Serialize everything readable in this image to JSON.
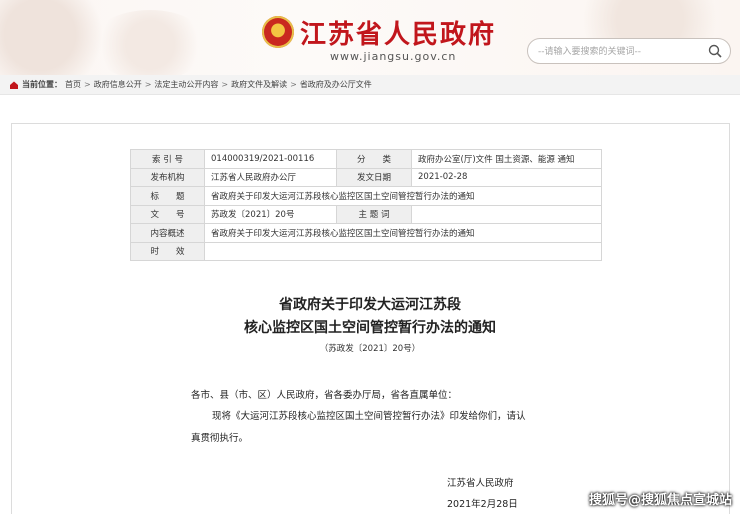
{
  "header": {
    "site_title": "江苏省人民政府",
    "site_url": "www.jiangsu.gov.cn",
    "search_placeholder": "--请输入要搜索的关键词--"
  },
  "breadcrumb": {
    "label": "当前位置：",
    "items": [
      "首页",
      "政府信息公开",
      "法定主动公开内容",
      "政府文件及解读",
      "省政府及办公厅文件"
    ]
  },
  "meta": {
    "rows": [
      {
        "k1": "索 引 号",
        "v1": "014000319/2021-00116",
        "k2": "分　　类",
        "v2": "政府办公室(厅)文件 国土资源、能源 通知"
      },
      {
        "k1": "发布机构",
        "v1": "江苏省人民政府办公厅",
        "k2": "发文日期",
        "v2": "2021-02-28"
      },
      {
        "k1": "标　　题",
        "v1": "省政府关于印发大运河江苏段核心监控区国土空间管控暂行办法的通知"
      },
      {
        "k1": "文　　号",
        "v1": "苏政发〔2021〕20号",
        "k2": "主 题 词",
        "v2": ""
      },
      {
        "k1": "内容概述",
        "v1": "省政府关于印发大运河江苏段核心监控区国土空间管控暂行办法的通知"
      },
      {
        "k1": "时　　效",
        "v1": ""
      }
    ]
  },
  "document": {
    "title_line1": "省政府关于印发大运河江苏段",
    "title_line2": "核心监控区国土空间管控暂行办法的通知",
    "number": "（苏政发〔2021〕20号）",
    "salutation": "各市、县（市、区）人民政府，省各委办厅局，省各直属单位：",
    "body_line1": "现将《大运河江苏段核心监控区国土空间管控暂行办法》印发给你们，请认",
    "body_line2": "真贯彻执行。",
    "signature": "江苏省人民政府",
    "date": "2021年2月28日"
  },
  "watermark": "搜狐号@搜狐焦点宣城站"
}
